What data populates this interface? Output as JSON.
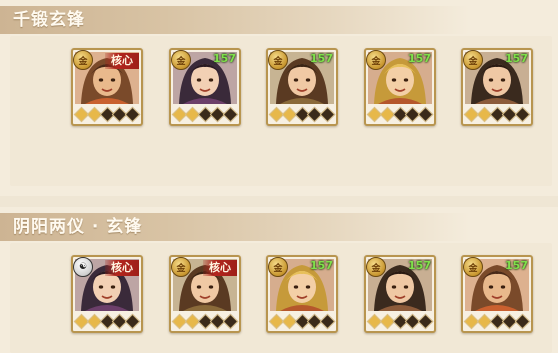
{
  "sections": [
    {
      "title": "千锻玄锋",
      "heroes": [
        {
          "badge": "core",
          "core_label": "核心",
          "icon": "gold-coin-icon",
          "level": "",
          "stars_lit": 2
        },
        {
          "badge": "level",
          "core_label": "",
          "icon": "gold-coin-icon",
          "level": "157",
          "stars_lit": 2
        },
        {
          "badge": "level",
          "core_label": "",
          "icon": "gold-coin-icon",
          "level": "157",
          "stars_lit": 2
        },
        {
          "badge": "level",
          "core_label": "",
          "icon": "gold-coin-icon",
          "level": "157",
          "stars_lit": 2
        },
        {
          "badge": "level",
          "core_label": "",
          "icon": "gold-coin-icon",
          "level": "157",
          "stars_lit": 2
        }
      ]
    },
    {
      "title": "阴阳两仪 · 玄锋",
      "heroes": [
        {
          "badge": "core",
          "core_label": "核心",
          "icon": "yin-yang-icon",
          "level": "",
          "stars_lit": 2
        },
        {
          "badge": "core",
          "core_label": "核心",
          "icon": "gold-coin-icon",
          "level": "",
          "stars_lit": 2
        },
        {
          "badge": "level",
          "core_label": "",
          "icon": "gold-coin-icon",
          "level": "157",
          "stars_lit": 2
        },
        {
          "badge": "level",
          "core_label": "",
          "icon": "gold-coin-icon",
          "level": "157",
          "stars_lit": 2
        },
        {
          "badge": "level",
          "core_label": "",
          "icon": "gold-coin-icon",
          "level": "157",
          "stars_lit": 2
        }
      ]
    }
  ],
  "colors": {
    "frame": "#b8954f",
    "core_tag": "#b3261e",
    "level_text": "#7fe04a",
    "header_text": "#fffaf0"
  }
}
